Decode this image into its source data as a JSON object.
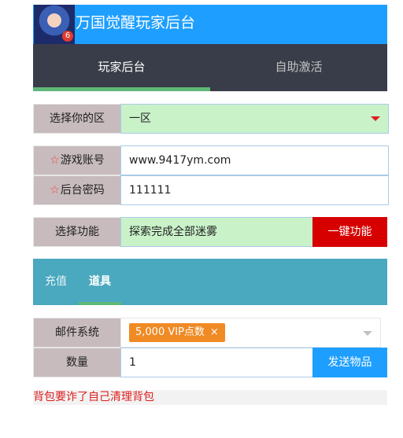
{
  "header": {
    "title": "万国觉醒玩家后台",
    "logo_badge": "6"
  },
  "top_tabs": [
    {
      "label": "玩家后台",
      "active": true
    },
    {
      "label": "自助激活",
      "active": false
    }
  ],
  "form": {
    "region": {
      "label": "选择你的区",
      "value": "一区"
    },
    "account": {
      "star": "☆",
      "label": "游戏账号",
      "value": "www.9417ym.com"
    },
    "password": {
      "star": "☆",
      "label": "后台密码",
      "value": "111111"
    },
    "function": {
      "label": "选择功能",
      "value": "探索完成全部迷雾",
      "button": "一键功能"
    }
  },
  "sub_tabs": [
    {
      "label": "充值",
      "active": false
    },
    {
      "label": "道具",
      "active": true
    }
  ],
  "mail": {
    "label": "邮件系统",
    "chip": "5,000 VIP点数",
    "chip_close": "×"
  },
  "quantity": {
    "label": "数量",
    "value": "1",
    "button": "发送物品"
  },
  "notice": "背包要诈了自己清理背包",
  "colors": {
    "header_blue": "#1e9fff",
    "nav_dark": "#393d49",
    "active_underline": "#5fb878",
    "label_bg": "#c7bbbd",
    "field_green": "#c9f2c9",
    "button_red": "#d60000",
    "subnav_teal": "#4aa8bf",
    "chip_orange": "#f08a24",
    "notice_red": "#e01d1d"
  }
}
